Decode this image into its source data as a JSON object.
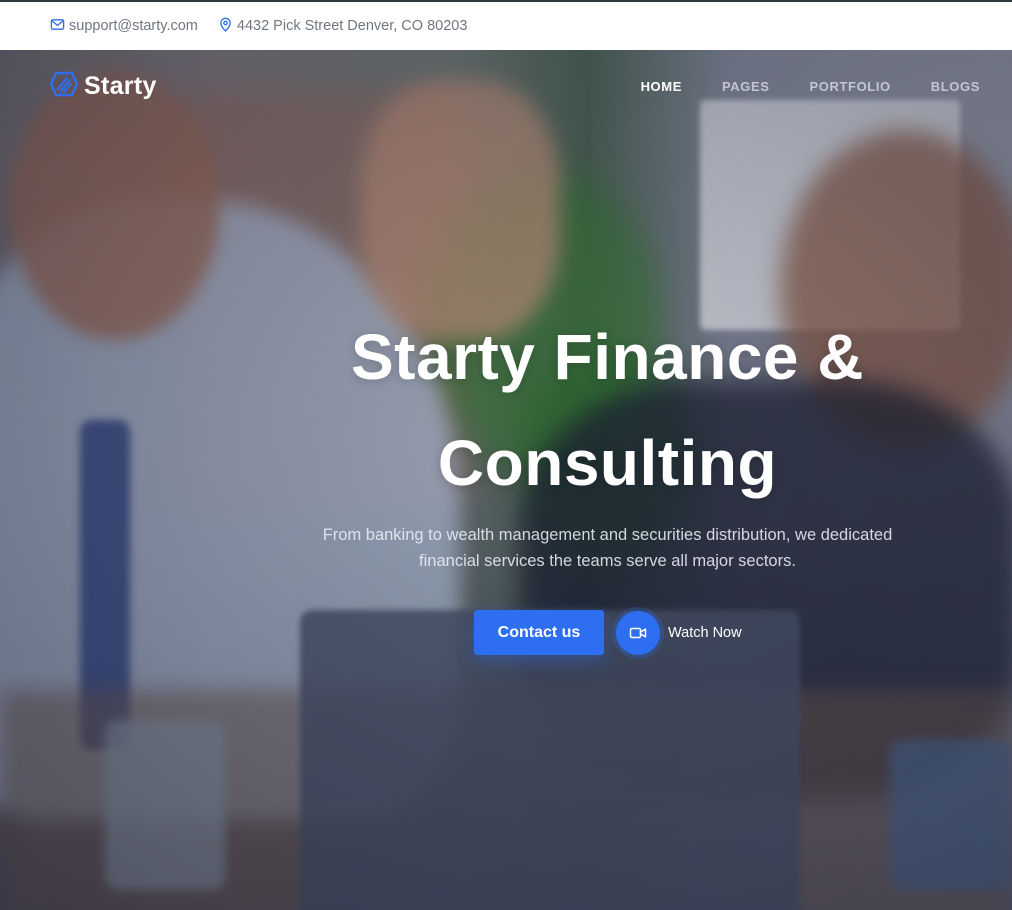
{
  "topbar": {
    "email": "support@starty.com",
    "address": "4432 Pick Street Denver, CO 80203"
  },
  "brand": {
    "name": "Starty",
    "accent": "#2d6ff0"
  },
  "nav": {
    "items": [
      {
        "label": "HOME",
        "active": true
      },
      {
        "label": "PAGES",
        "active": false
      },
      {
        "label": "PORTFOLIO",
        "active": false
      },
      {
        "label": "BLOGS",
        "active": false
      }
    ]
  },
  "hero": {
    "title_line1": "Starty Finance &",
    "title_line2": "Consulting",
    "subtitle": "From banking to wealth management and securities distribution, we dedicated financial services the teams serve all major sectors.",
    "primary_button": "Contact us",
    "video_link": "Watch Now",
    "video_icon": "video-camera-icon"
  }
}
